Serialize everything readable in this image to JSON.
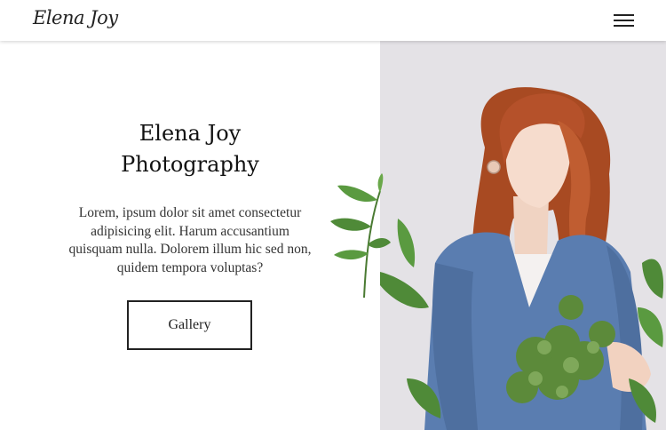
{
  "header": {
    "logo": "Elena Joy",
    "menu_icon": "hamburger-menu-icon"
  },
  "hero": {
    "title_line1": "Elena Joy",
    "title_line2": "Photography",
    "description_line1": "Lorem, ipsum dolor sit amet consectetur",
    "description_line2": "adipisicing elit. Harum accusantium",
    "description_line3": "quisquam nulla. Dolorem illum hic sed non,",
    "description_line4": "quidem tempora voluptas?",
    "cta_label": "Gallery"
  },
  "image": {
    "subject": "woman-with-greenery-photo",
    "background_color": "#e3e1e5",
    "sweater_color": "#5a7db0",
    "hair_color": "#b5512a",
    "leaf_color": "#5c8a3a"
  }
}
